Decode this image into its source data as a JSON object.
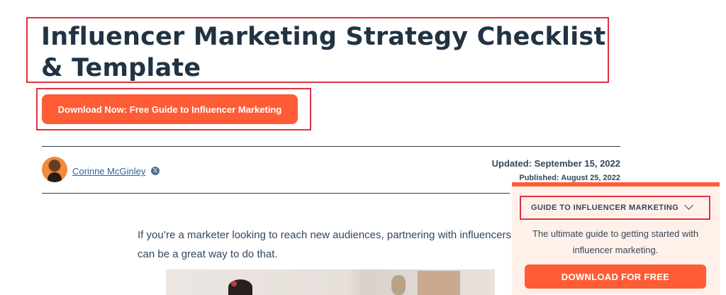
{
  "article": {
    "title": "Influencer Marketing Strategy Checklist & Template",
    "cta_label": "Download Now: Free Guide to Influencer Marketing",
    "author": "Corinne McGinley",
    "social_badge": "𝕏",
    "updated": "Updated: September 15, 2022",
    "published": "Published: August 25, 2022",
    "intro": "If you’re a marketer looking to reach new audiences, partnering with influencers can be a great way to do that."
  },
  "sidebar_card": {
    "heading": "GUIDE TO INFLUENCER MARKETING",
    "description": "The ultimate guide to getting started with influencer marketing.",
    "button_label": "DOWNLOAD FOR FREE"
  },
  "colors": {
    "accent": "#ff5c35",
    "text": "#213343",
    "highlight_box": "#e0323f",
    "card_bg": "#fff1ea",
    "link": "#2f5fa8"
  },
  "icons": [
    "chevron-down-icon",
    "x-social-icon"
  ]
}
